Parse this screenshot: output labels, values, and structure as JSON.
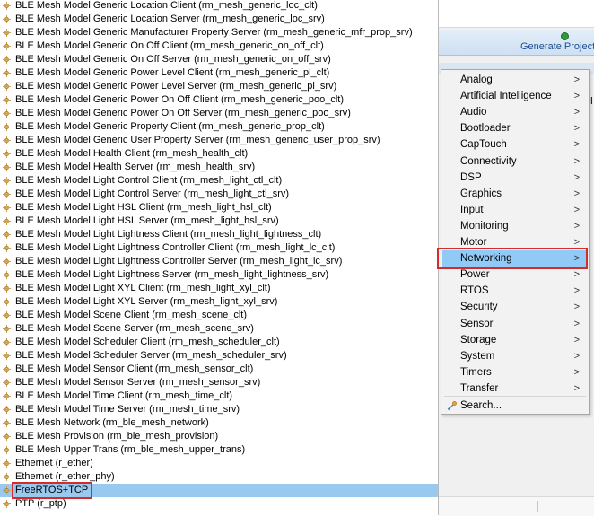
{
  "modules": [
    "BLE Mesh Model Generic Location Client (rm_mesh_generic_loc_clt)",
    "BLE Mesh Model Generic Location Server (rm_mesh_generic_loc_srv)",
    "BLE Mesh Model Generic Manufacturer Property Server (rm_mesh_generic_mfr_prop_srv)",
    "BLE Mesh Model Generic On Off Client (rm_mesh_generic_on_off_clt)",
    "BLE Mesh Model Generic On Off Server (rm_mesh_generic_on_off_srv)",
    "BLE Mesh Model Generic Power Level Client (rm_mesh_generic_pl_clt)",
    "BLE Mesh Model Generic Power Level Server (rm_mesh_generic_pl_srv)",
    "BLE Mesh Model Generic Power On Off Client (rm_mesh_generic_poo_clt)",
    "BLE Mesh Model Generic Power On Off Server (rm_mesh_generic_poo_srv)",
    "BLE Mesh Model Generic Property Client (rm_mesh_generic_prop_clt)",
    "BLE Mesh Model Generic User Property Server (rm_mesh_generic_user_prop_srv)",
    "BLE Mesh Model Health Client (rm_mesh_health_clt)",
    "BLE Mesh Model Health Server (rm_mesh_health_srv)",
    "BLE Mesh Model Light Control Client (rm_mesh_light_ctl_clt)",
    "BLE Mesh Model Light Control Server (rm_mesh_light_ctl_srv)",
    "BLE Mesh Model Light HSL Client (rm_mesh_light_hsl_clt)",
    "BLE Mesh Model Light HSL Server (rm_mesh_light_hsl_srv)",
    "BLE Mesh Model Light Lightness Client (rm_mesh_light_lightness_clt)",
    "BLE Mesh Model Light Lightness Controller Client (rm_mesh_light_lc_clt)",
    "BLE Mesh Model Light Lightness Controller Server (rm_mesh_light_lc_srv)",
    "BLE Mesh Model Light Lightness Server (rm_mesh_light_lightness_srv)",
    "BLE Mesh Model Light XYL Client (rm_mesh_light_xyl_clt)",
    "BLE Mesh Model Light XYL Server (rm_mesh_light_xyl_srv)",
    "BLE Mesh Model Scene Client (rm_mesh_scene_clt)",
    "BLE Mesh Model Scene Server (rm_mesh_scene_srv)",
    "BLE Mesh Model Scheduler Client (rm_mesh_scheduler_clt)",
    "BLE Mesh Model Scheduler Server (rm_mesh_scheduler_srv)",
    "BLE Mesh Model Sensor Client (rm_mesh_sensor_clt)",
    "BLE Mesh Model Sensor Server (rm_mesh_sensor_srv)",
    "BLE Mesh Model Time Client (rm_mesh_time_clt)",
    "BLE Mesh Model Time Server (rm_mesh_time_srv)",
    "BLE Mesh Network (rm_ble_mesh_network)",
    "BLE Mesh Provision (rm_ble_mesh_provision)",
    "BLE Mesh Upper Trans (rm_ble_mesh_upper_trans)",
    "Ethernet (r_ether)",
    "Ethernet (r_ether_phy)",
    "FreeRTOS+TCP",
    "PTP (r_ptp)"
  ],
  "selected_module_index": 36,
  "toolbar": {
    "generate_label": "Generate Project"
  },
  "partial_right_text": [
    "a",
    "ol"
  ],
  "menu": {
    "categories": [
      "Analog",
      "Artificial Intelligence",
      "Audio",
      "Bootloader",
      "CapTouch",
      "Connectivity",
      "DSP",
      "Graphics",
      "Input",
      "Monitoring",
      "Motor",
      "Networking",
      "Power",
      "RTOS",
      "Security",
      "Sensor",
      "Storage",
      "System",
      "Timers",
      "Transfer"
    ],
    "active_index": 11,
    "submenu_arrow": ">",
    "search_label": "Search..."
  },
  "colors": {
    "selection": "#99c9ef",
    "menu_highlight": "#91c9f7",
    "highlight_box": "#d62b2b",
    "toolbar_text": "#1d4f91"
  },
  "icons": {
    "module": "component-icon",
    "generate": "generate-icon",
    "search": "search-icon"
  }
}
